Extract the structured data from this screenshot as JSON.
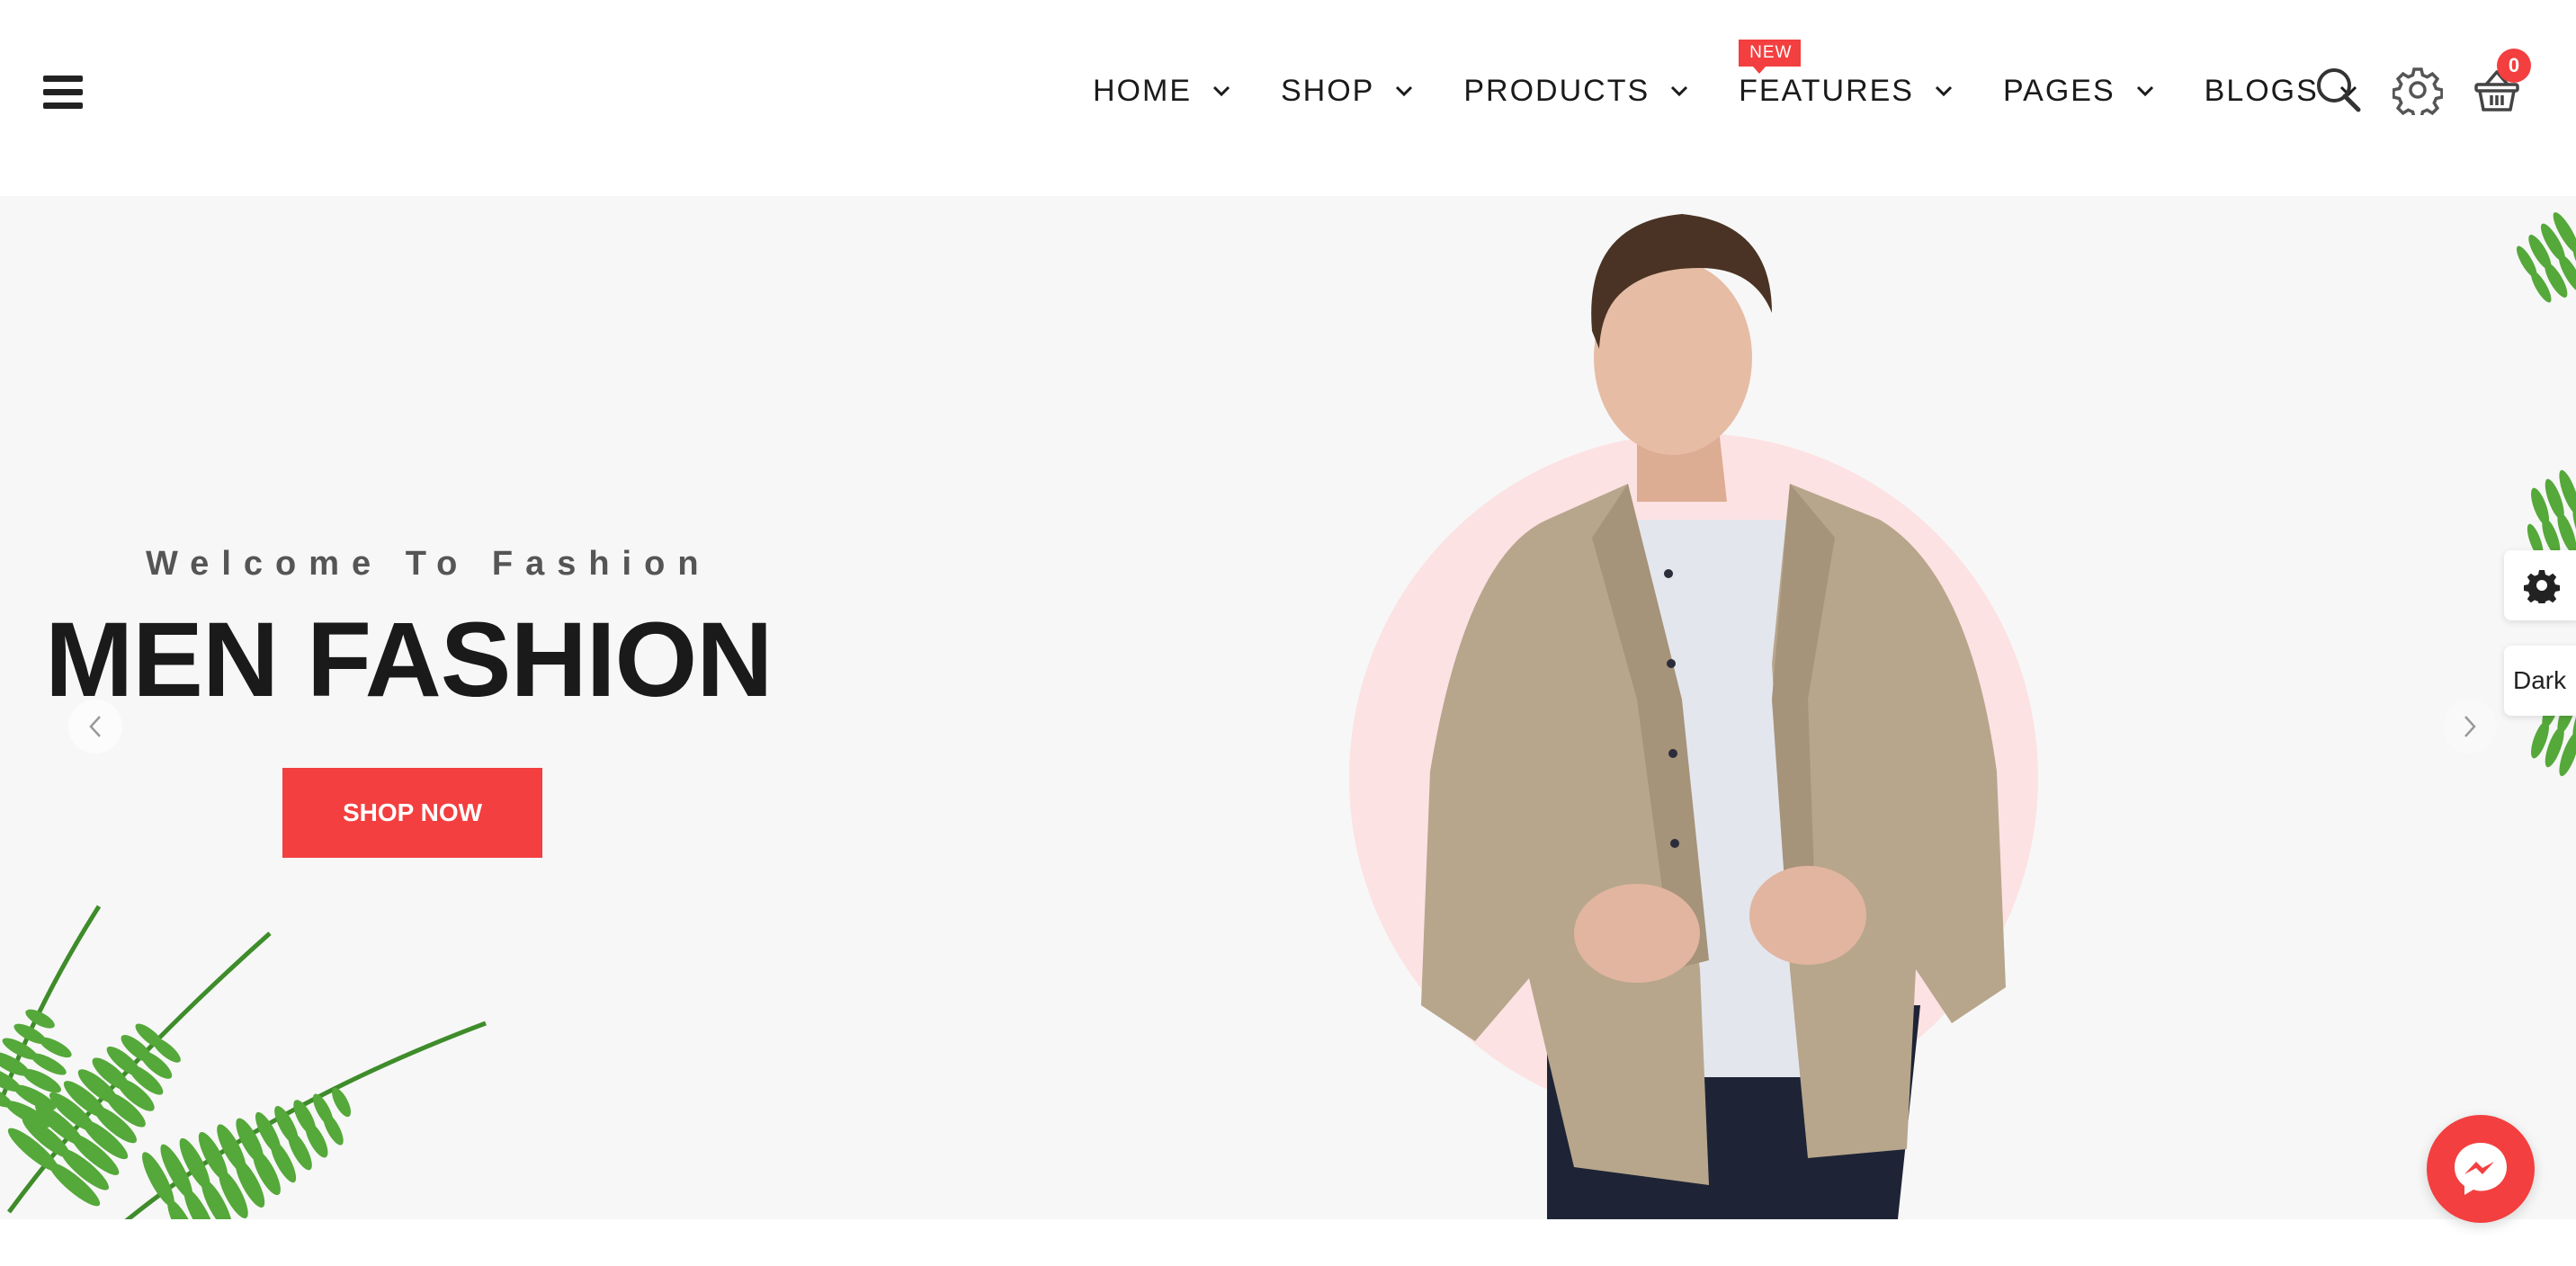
{
  "header": {
    "nav": [
      {
        "label": "HOME"
      },
      {
        "label": "SHOP"
      },
      {
        "label": "PRODUCTS"
      },
      {
        "label": "FEATURES",
        "badge": "NEW"
      },
      {
        "label": "PAGES"
      },
      {
        "label": "BLOGS"
      }
    ],
    "icons": {
      "menu": "hamburger-icon",
      "search": "search-icon",
      "settings": "gear-icon",
      "cart": "basket-icon"
    },
    "cart_count": "0"
  },
  "hero": {
    "subtitle": "Welcome To Fashion",
    "headline": "MEN FASHION",
    "cta_label": "SHOP NOW",
    "prev_icon": "chevron-left-icon",
    "next_icon": "chevron-right-icon"
  },
  "side_widgets": {
    "settings_icon": "gear-icon",
    "theme_label": "Dark"
  },
  "chat": {
    "icon": "messenger-icon"
  },
  "colors": {
    "accent": "#f33f3f",
    "hero_bg": "#f7f7f7",
    "circle": "#fde2e3",
    "text_dark": "#1a1a1a"
  }
}
